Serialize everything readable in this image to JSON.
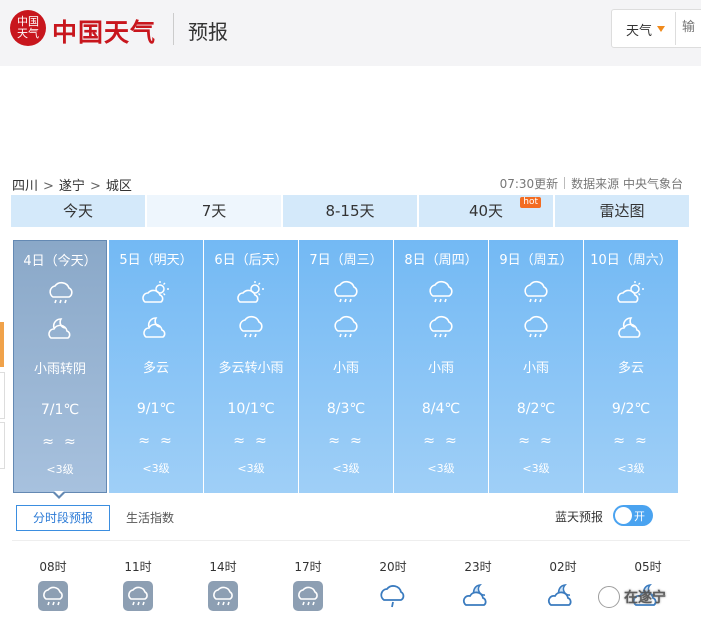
{
  "header": {
    "logo_seal": "中国天气",
    "logo_text": "中国天气",
    "page_label": "预报",
    "search": {
      "select_value": "天气",
      "placeholder": "输"
    }
  },
  "breadcrumb": [
    "四川",
    "遂宁",
    "城区"
  ],
  "breadcrumb_sep": ">",
  "meta": {
    "updated": "07:30更新",
    "source": "数据来源 中央气象台"
  },
  "tabs": [
    {
      "label": "今天"
    },
    {
      "label": "7天",
      "active": true
    },
    {
      "label": "8-15天"
    },
    {
      "label": "40天",
      "badge": "hot"
    },
    {
      "label": "雷达图"
    }
  ],
  "days": [
    {
      "title": "4日（今天）",
      "icon_day": "cloud-rain-icon",
      "icon_night": "moon-cloud-icon",
      "desc": "小雨转阴",
      "temp": "7/1℃",
      "wind": "≈≈",
      "level": "<3级",
      "today": true
    },
    {
      "title": "5日（明天）",
      "icon_day": "sun-cloud-icon",
      "icon_night": "moon-cloud-icon",
      "desc": "多云",
      "temp": "9/1℃",
      "wind": "≈≈",
      "level": "<3级"
    },
    {
      "title": "6日（后天）",
      "icon_day": "sun-cloud-icon",
      "icon_night": "cloud-rain-icon",
      "desc": "多云转小雨",
      "temp": "10/1℃",
      "wind": "≈≈",
      "level": "<3级"
    },
    {
      "title": "7日（周三）",
      "icon_day": "cloud-rain-icon",
      "icon_night": "cloud-rain-icon",
      "desc": "小雨",
      "temp": "8/3℃",
      "wind": "≈≈",
      "level": "<3级"
    },
    {
      "title": "8日（周四）",
      "icon_day": "cloud-rain-icon",
      "icon_night": "cloud-rain-icon",
      "desc": "小雨",
      "temp": "8/4℃",
      "wind": "≈≈",
      "level": "<3级"
    },
    {
      "title": "9日（周五）",
      "icon_day": "cloud-rain-icon",
      "icon_night": "cloud-rain-icon",
      "desc": "小雨",
      "temp": "8/2℃",
      "wind": "≈≈",
      "level": "<3级"
    },
    {
      "title": "10日（周六）",
      "icon_day": "sun-cloud-icon",
      "icon_night": "moon-cloud-icon",
      "desc": "多云",
      "temp": "9/2℃",
      "wind": "≈≈",
      "level": "<3级"
    }
  ],
  "subtabs": {
    "active": "分时段预报",
    "other": "生活指数"
  },
  "bluesky": {
    "label": "蓝天预报",
    "toggle": "开"
  },
  "hourly": [
    {
      "time": "08时",
      "icon": "cloud-rain-icon"
    },
    {
      "time": "11时",
      "icon": "cloud-rain-icon"
    },
    {
      "time": "14时",
      "icon": "cloud-rain-icon"
    },
    {
      "time": "17时",
      "icon": "cloud-rain-icon"
    },
    {
      "time": "20时",
      "icon": "cloud-rain-outline-icon"
    },
    {
      "time": "23时",
      "icon": "moon-cloud-outline-icon"
    },
    {
      "time": "02时",
      "icon": "moon-cloud-outline-icon"
    },
    {
      "time": "05时",
      "icon": "moon-cloud-outline-icon"
    }
  ],
  "watermark": "在遂宁",
  "colors": {
    "brand": "#c8161d",
    "accent": "#4aa3f0",
    "hot": "#f36c21"
  }
}
